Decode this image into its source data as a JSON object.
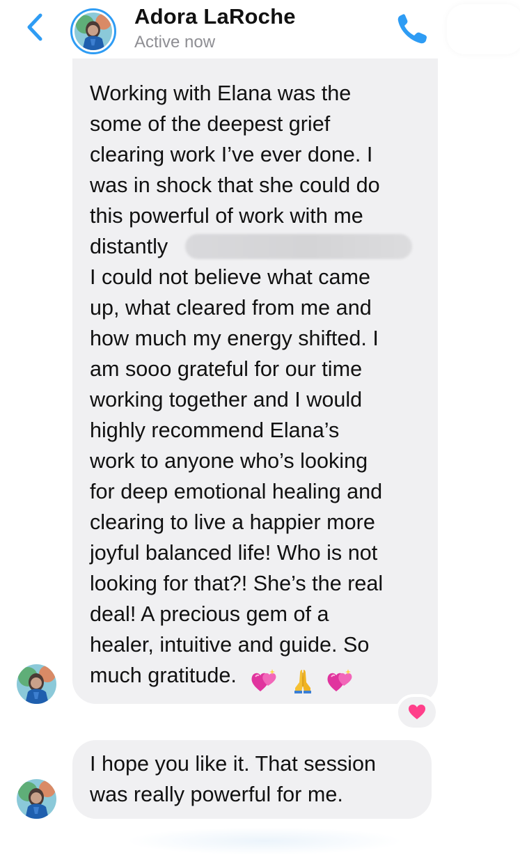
{
  "header": {
    "back_icon": "chevron-left-icon",
    "contact_name": "Adora LaRoche",
    "status": "Active now",
    "call_icon": "phone-icon",
    "accent_color": "#2e9cf4"
  },
  "messages": [
    {
      "sender": "contact",
      "lines": [
        "Working with Elana was the",
        "some of the deepest grief",
        "clearing work I’ve ever done. I",
        "was in shock that she could do",
        "this powerful of work with me",
        "distantly",
        "I could not believe what came",
        "up, what cleared from me and",
        "how much my energy shifted. I",
        "am sooo grateful for our time",
        "working together and I would",
        "highly recommend Elana’s",
        "work to anyone who’s looking",
        "for deep emotional healing and",
        "clearing to live a happier more",
        "joyful balanced life! Who is not",
        "looking for that?! She’s the real",
        "deal! A precious gem of a",
        "healer, intuitive and guide. So",
        "much gratitude."
      ],
      "emojis": [
        "💞",
        "🙏",
        "💞"
      ],
      "reaction": "heart-reaction",
      "reaction_color": "#ff3f8a"
    },
    {
      "sender": "contact",
      "lines": [
        "I hope you like it. That session",
        "was really powerful for me."
      ]
    }
  ],
  "colors": {
    "bubble": "#f0f0f2",
    "secondary_text": "#8e8e93"
  }
}
